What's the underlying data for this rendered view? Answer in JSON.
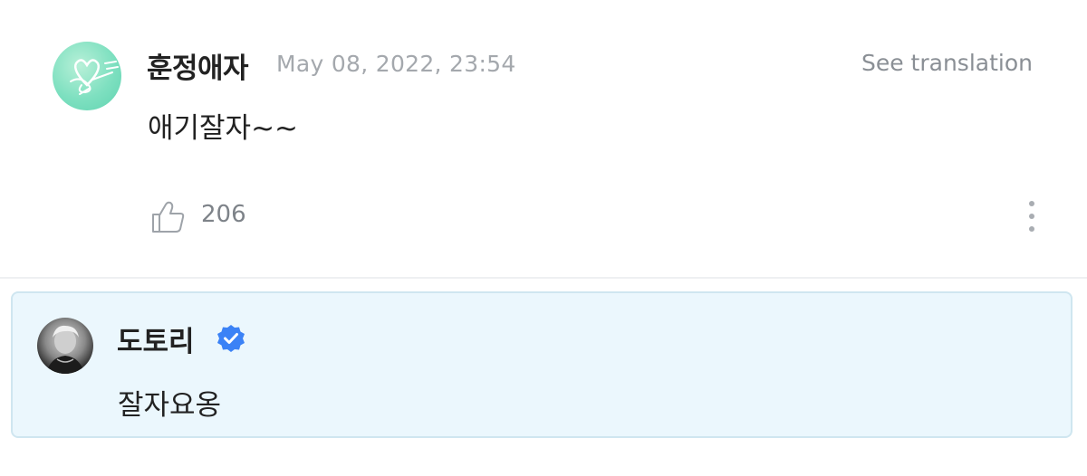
{
  "comment": {
    "username": "훈정애자",
    "timestamp": "May 08, 2022, 23:54",
    "see_translation": "See translation",
    "text": "애기잘자~~",
    "like_count": "206",
    "icons": {
      "avatar": "avatar-heart-drawing",
      "like": "thumbs-up-icon",
      "more": "more-vertical-icon"
    }
  },
  "reply": {
    "username": "도토리",
    "text": "잘자요옹",
    "verified_icon": "verified-badge-icon",
    "colors": {
      "background": "#ebf7fd",
      "border": "#cfe6f0",
      "verified": "#3b82f6"
    }
  }
}
